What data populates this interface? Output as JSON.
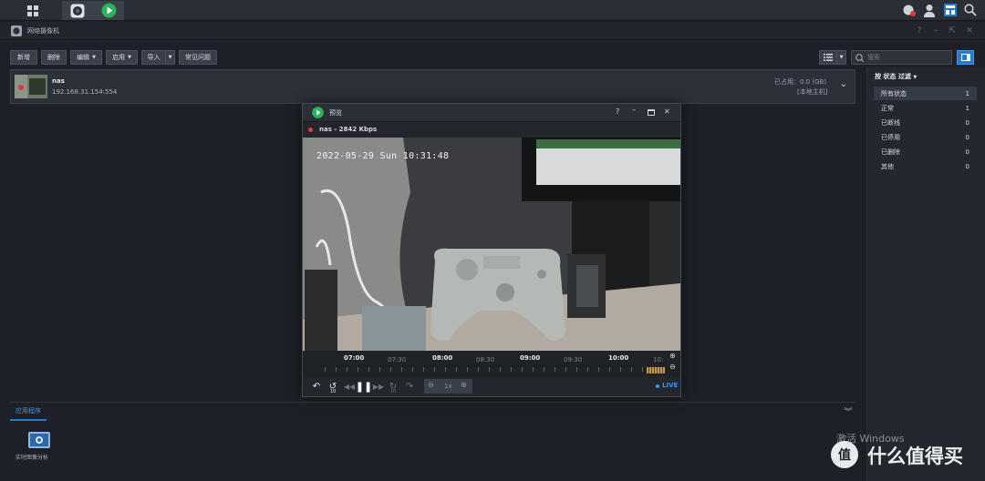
{
  "window": {
    "title": "网络摄像机"
  },
  "toolbar": {
    "add_label": "新增",
    "delete_label": "删除",
    "edit_label": "编辑",
    "enable_label": "启用",
    "import_label": "导入",
    "faq_label": "常见问题"
  },
  "search": {
    "placeholder": "搜索"
  },
  "camera": {
    "name": "nas",
    "address": "192.168.31.154:554",
    "usage": "已占用：0.0 (GB)",
    "host": "[本地主机]"
  },
  "filter": {
    "title": "按 状态 过滤",
    "items": [
      {
        "label": "所有状态",
        "count": "1"
      },
      {
        "label": "正常",
        "count": "1"
      },
      {
        "label": "已断线",
        "count": "0"
      },
      {
        "label": "已停用",
        "count": "0"
      },
      {
        "label": "已删除",
        "count": "0"
      },
      {
        "label": "其他",
        "count": "0"
      }
    ]
  },
  "app_panel": {
    "tab_label": "应用程序",
    "app_label": "实时图像分析"
  },
  "preview": {
    "title": "预览",
    "stream_label": "nas - 2842 Kbps",
    "osd_timestamp": "2022-05-29 Sun 10:31:48",
    "help": "?",
    "timeline_labels": [
      "07:00",
      "07:30",
      "08:00",
      "08:30",
      "09:00",
      "09:30",
      "10:00",
      "10:"
    ],
    "speed": "1x",
    "live_label": "LIVE",
    "skip_back_value": "10",
    "skip_fwd_value": "10"
  },
  "watermark": {
    "activate": "激活 Windows",
    "site": "什么值得买"
  },
  "colors": {
    "accent": "#1f7dd4",
    "record_dot": "#e23b3b",
    "play_green": "#2bb35a"
  }
}
